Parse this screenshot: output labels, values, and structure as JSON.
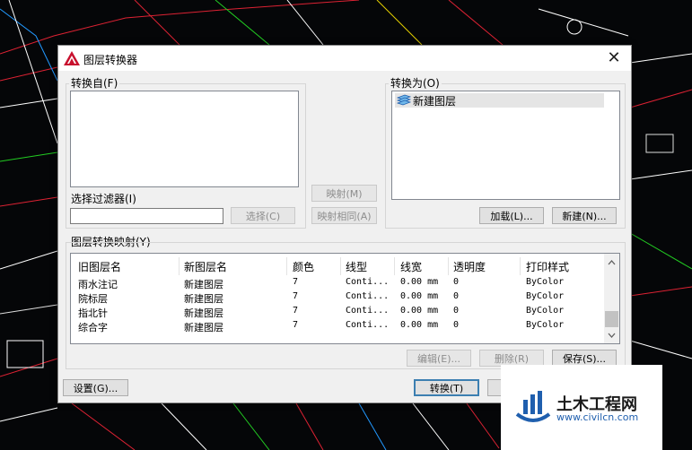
{
  "dialog": {
    "title": "图层转换器",
    "close_glyph": "✕"
  },
  "from_group": {
    "label": "转换自(F)",
    "filter_label": "选择过滤器(I)",
    "filter_value": "",
    "select_button": "选择(C)"
  },
  "mapping_buttons": {
    "map": "映射(M)",
    "map_same": "映射相同(A)"
  },
  "to_group": {
    "label": "转换为(O)",
    "items": [
      "新建图层"
    ],
    "load_button": "加载(L)...",
    "new_button": "新建(N)..."
  },
  "map_group": {
    "label": "图层转换映射(Y)",
    "columns": [
      "旧图层名",
      "新图层名",
      "颜色",
      "线型",
      "线宽",
      "透明度",
      "打印样式"
    ],
    "rows": [
      {
        "old": "雨水注记",
        "new": "新建图层",
        "color": "7",
        "linetype": "Conti...",
        "lineweight": "0.00 mm",
        "transparency": "0",
        "plotstyle": "ByColor"
      },
      {
        "old": "院标层",
        "new": "新建图层",
        "color": "7",
        "linetype": "Conti...",
        "lineweight": "0.00 mm",
        "transparency": "0",
        "plotstyle": "ByColor"
      },
      {
        "old": "指北针",
        "new": "新建图层",
        "color": "7",
        "linetype": "Conti...",
        "lineweight": "0.00 mm",
        "transparency": "0",
        "plotstyle": "ByColor"
      },
      {
        "old": "综合字",
        "new": "新建图层",
        "color": "7",
        "linetype": "Conti...",
        "lineweight": "0.00 mm",
        "transparency": "0",
        "plotstyle": "ByColor"
      }
    ],
    "edit_button": "编辑(E)...",
    "delete_button": "删除(R)",
    "save_button": "保存(S)..."
  },
  "bottom": {
    "settings_button": "设置(G)...",
    "convert_button": "转换(T)"
  },
  "watermark": {
    "name": "土木工程网",
    "url": "www.civilcn.com"
  },
  "colors": {
    "accent": "#3c7fb1",
    "autocad_red": "#c8102e",
    "logo_blue": "#1f5fae"
  }
}
